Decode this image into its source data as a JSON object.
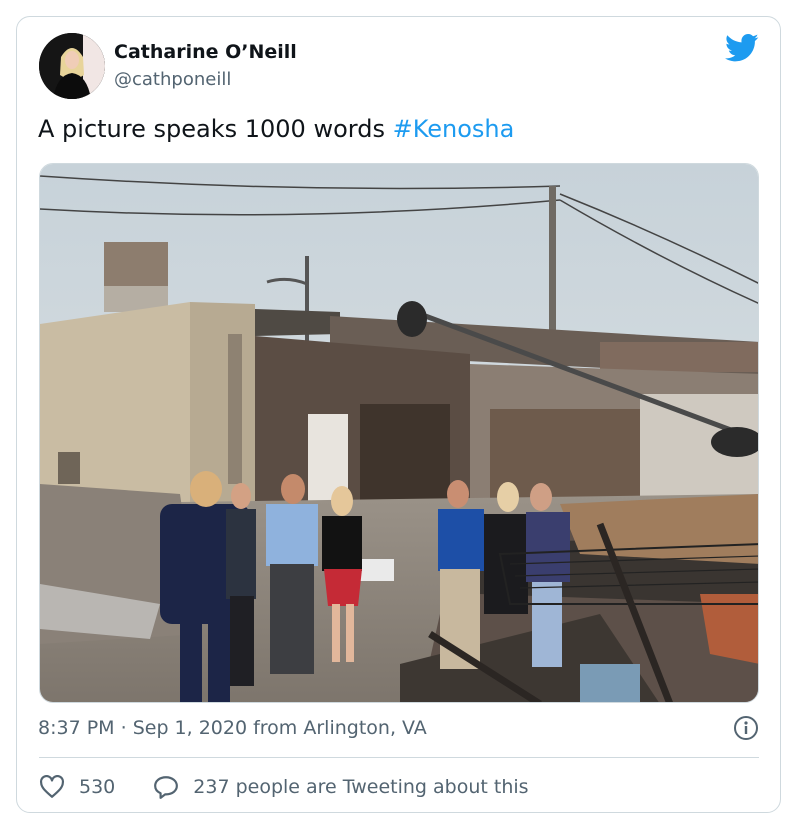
{
  "author": {
    "name": "Catharine O’Neill",
    "handle": "@cathponeill",
    "avatar_icon": "profile-photo"
  },
  "tweet": {
    "text": "A picture speaks 1000 words ",
    "hashtag": "#Kenosha"
  },
  "meta": {
    "time": "8:37 PM",
    "separator": " · ",
    "date": "Sep 1, 2020",
    "source": " from Arlington, VA"
  },
  "actions": {
    "likes": "530",
    "replies_text": "237 people are Tweeting about this"
  },
  "colors": {
    "accent": "#1d9bf0",
    "text": "#0f1419",
    "secondary": "#536471",
    "border": "#cfd9de"
  },
  "icons": [
    "twitter-bird-icon",
    "info-icon",
    "heart-icon",
    "reply-bubble-icon"
  ]
}
